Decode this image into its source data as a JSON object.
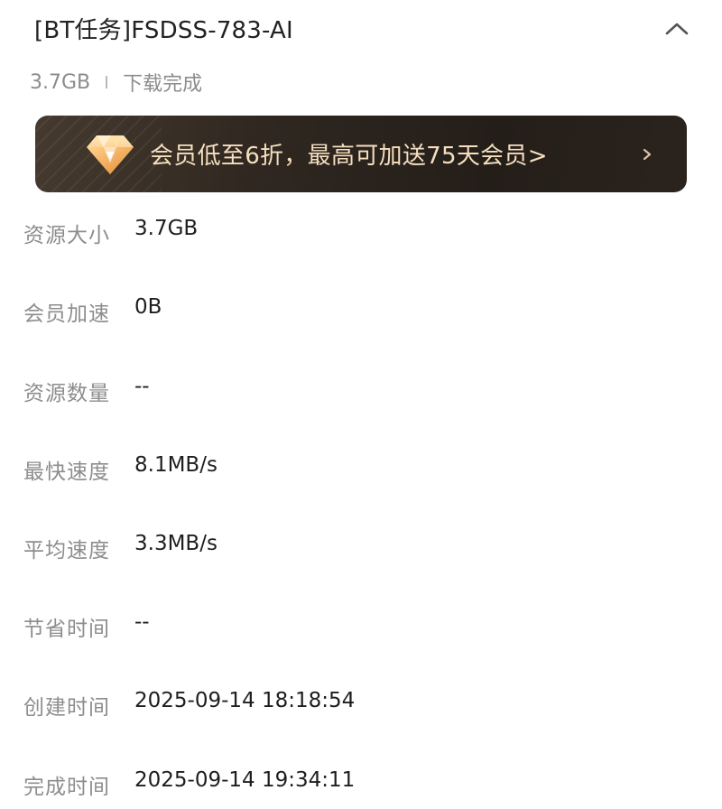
{
  "task": {
    "title": "[BT任务]FSDSS-783-AI",
    "size": "3.7GB",
    "status": "下载完成"
  },
  "banner": {
    "text": "会员低至6折，最高可加送75天会员>",
    "icon": "diamond-icon",
    "arrow_icon": "chevron-right-icon",
    "text_color": "#f6dfbf"
  },
  "details": [
    {
      "label": "资源大小",
      "value": "3.7GB"
    },
    {
      "label": "会员加速",
      "value": "0B"
    },
    {
      "label": "资源数量",
      "value": "--"
    },
    {
      "label": "最快速度",
      "value": "8.1MB/s"
    },
    {
      "label": "平均速度",
      "value": "3.3MB/s"
    },
    {
      "label": "节省时间",
      "value": "--"
    },
    {
      "label": "创建时间",
      "value": "2025-09-14 18:18:54"
    },
    {
      "label": "完成时间",
      "value": "2025-09-14 19:34:11"
    }
  ]
}
